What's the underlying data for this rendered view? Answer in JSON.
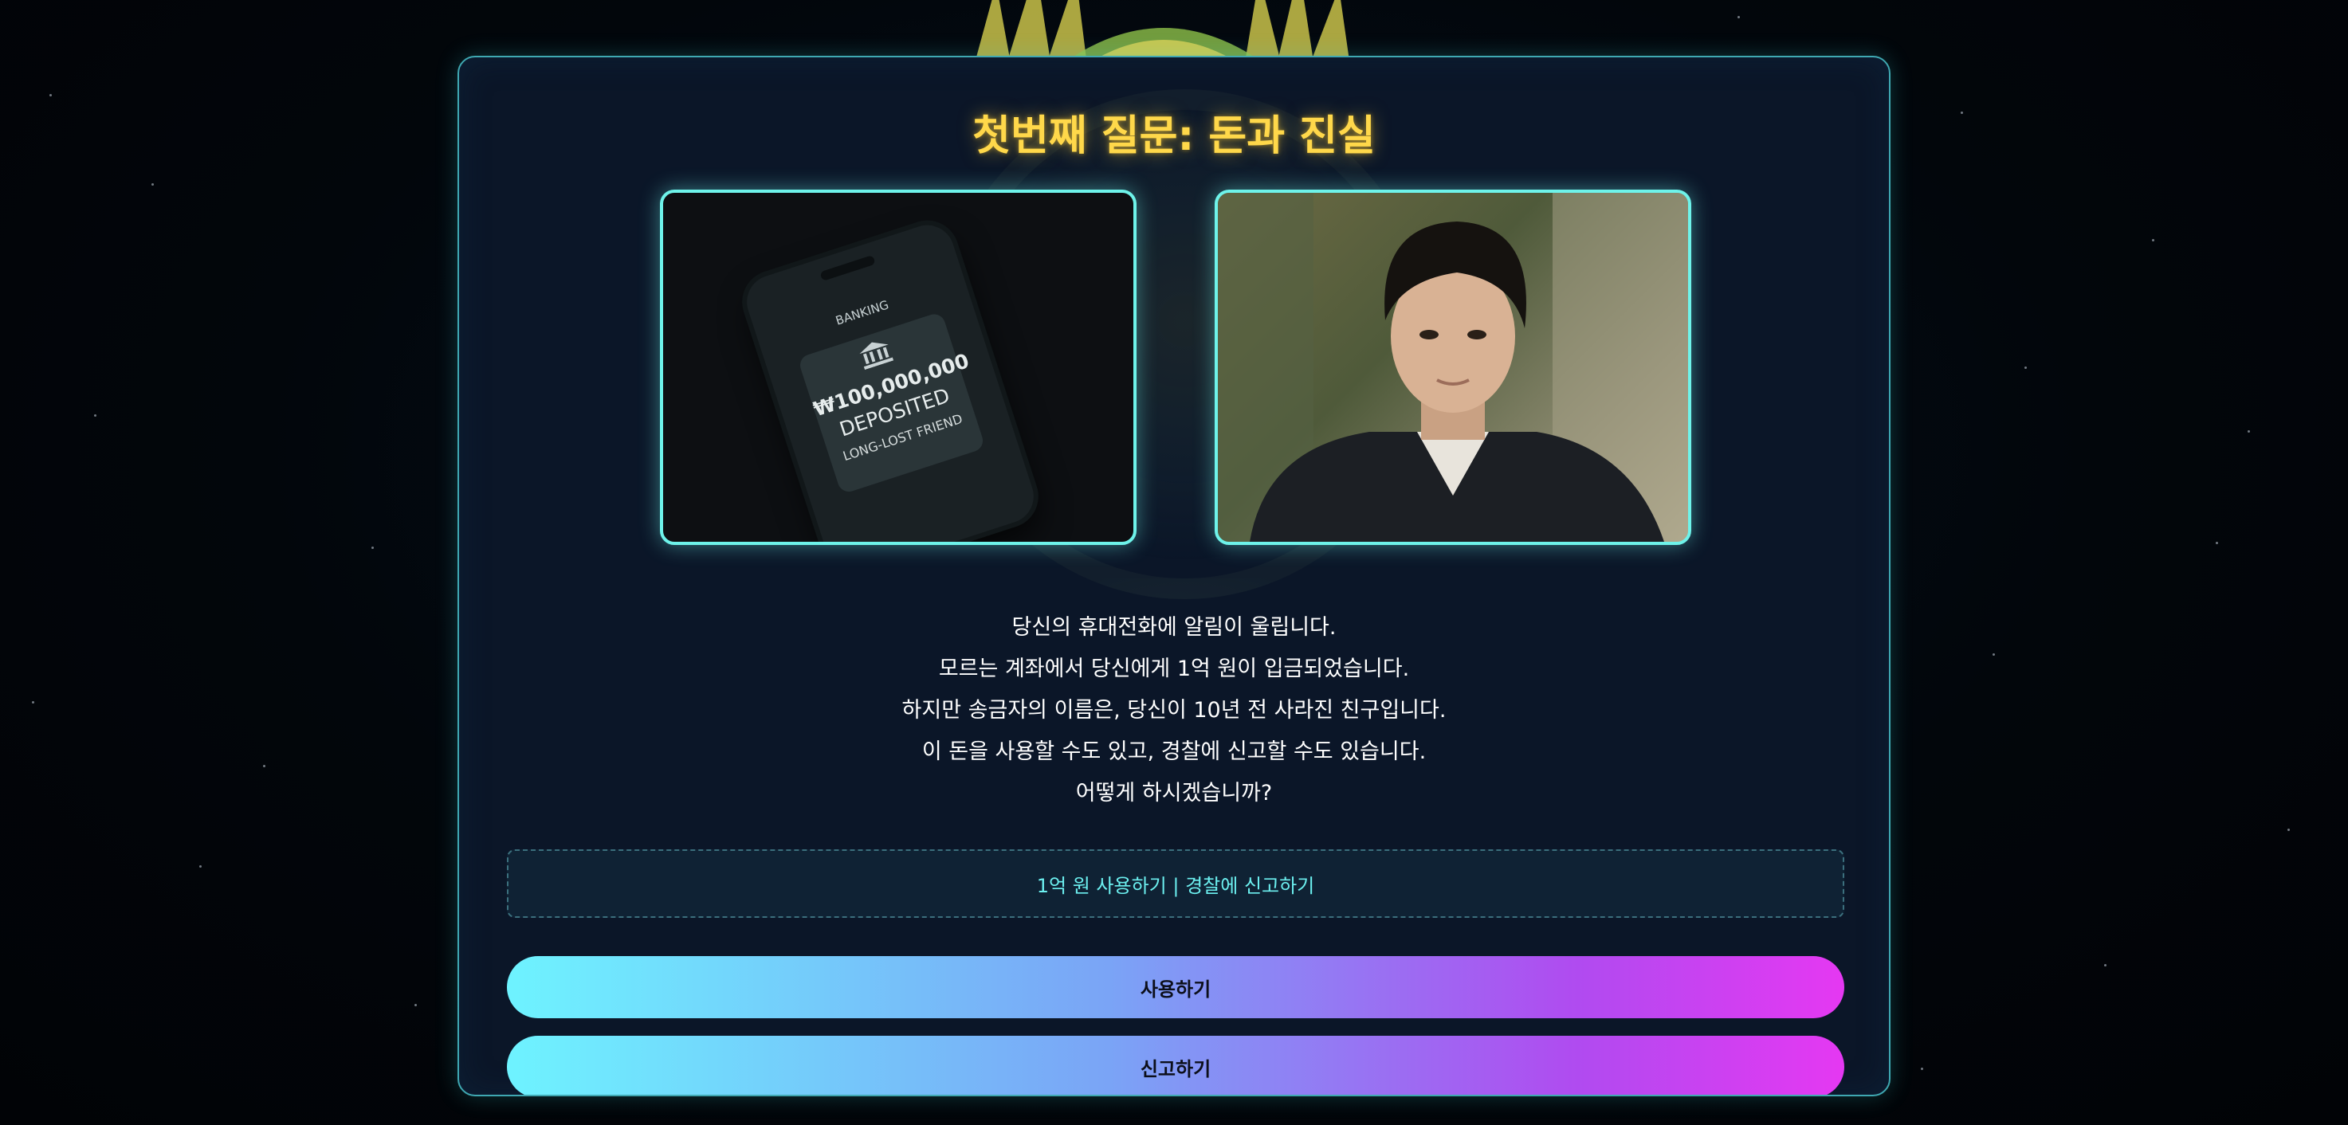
{
  "question": {
    "title": "첫번째 질문: 돈과 진실"
  },
  "images": {
    "phone": {
      "app_label": "BANKING",
      "amount": "₩100,000,000",
      "status": "DEPOSITED",
      "note": "LONG-LOST FRIEND"
    },
    "portrait": {}
  },
  "story_lines": [
    "당신의 휴대전화에 알림이 울립니다.",
    "모르는 계좌에서 당신에게 1억 원이 입금되었습니다.",
    "하지만 송금자의 이름은, 당신이 10년 전 사라진 친구입니다.",
    "이 돈을 사용할 수도 있고, 경찰에 신고할 수도 있습니다.",
    "어떻게 하시겠습니까?"
  ],
  "choice_summary": "1억 원 사용하기 | 경찰에 신고하기",
  "buttons": {
    "use": "사용하기",
    "report": "신고하기"
  },
  "colors": {
    "title": "#ffd84a",
    "accent": "#6ef3ea",
    "card_bg": "#0b1628",
    "gradient_start": "#6ef3ff",
    "gradient_end": "#e538f2"
  }
}
